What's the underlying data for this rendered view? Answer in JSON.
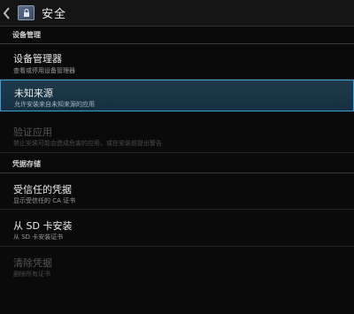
{
  "actionbar": {
    "title": "安全"
  },
  "sections": {
    "device": "设备管理",
    "credentials": "凭据存储"
  },
  "prefs": {
    "device_admin": {
      "title": "设备管理器",
      "summary": "查看或停用设备管理器"
    },
    "unknown_sources": {
      "title": "未知来源",
      "summary": "允许安装来自未知来源的应用"
    },
    "verify_apps": {
      "title": "验证应用",
      "summary": "禁止安装可能会造成危害的应用，或在安装前提出警告"
    },
    "trusted_creds": {
      "title": "受信任的凭据",
      "summary": "显示受信任的 CA 证书"
    },
    "install_sd": {
      "title": "从 SD 卡安装",
      "summary": "从 SD 卡安装证书"
    },
    "clear_creds": {
      "title": "清除凭据",
      "summary": "删除所有证书"
    }
  }
}
